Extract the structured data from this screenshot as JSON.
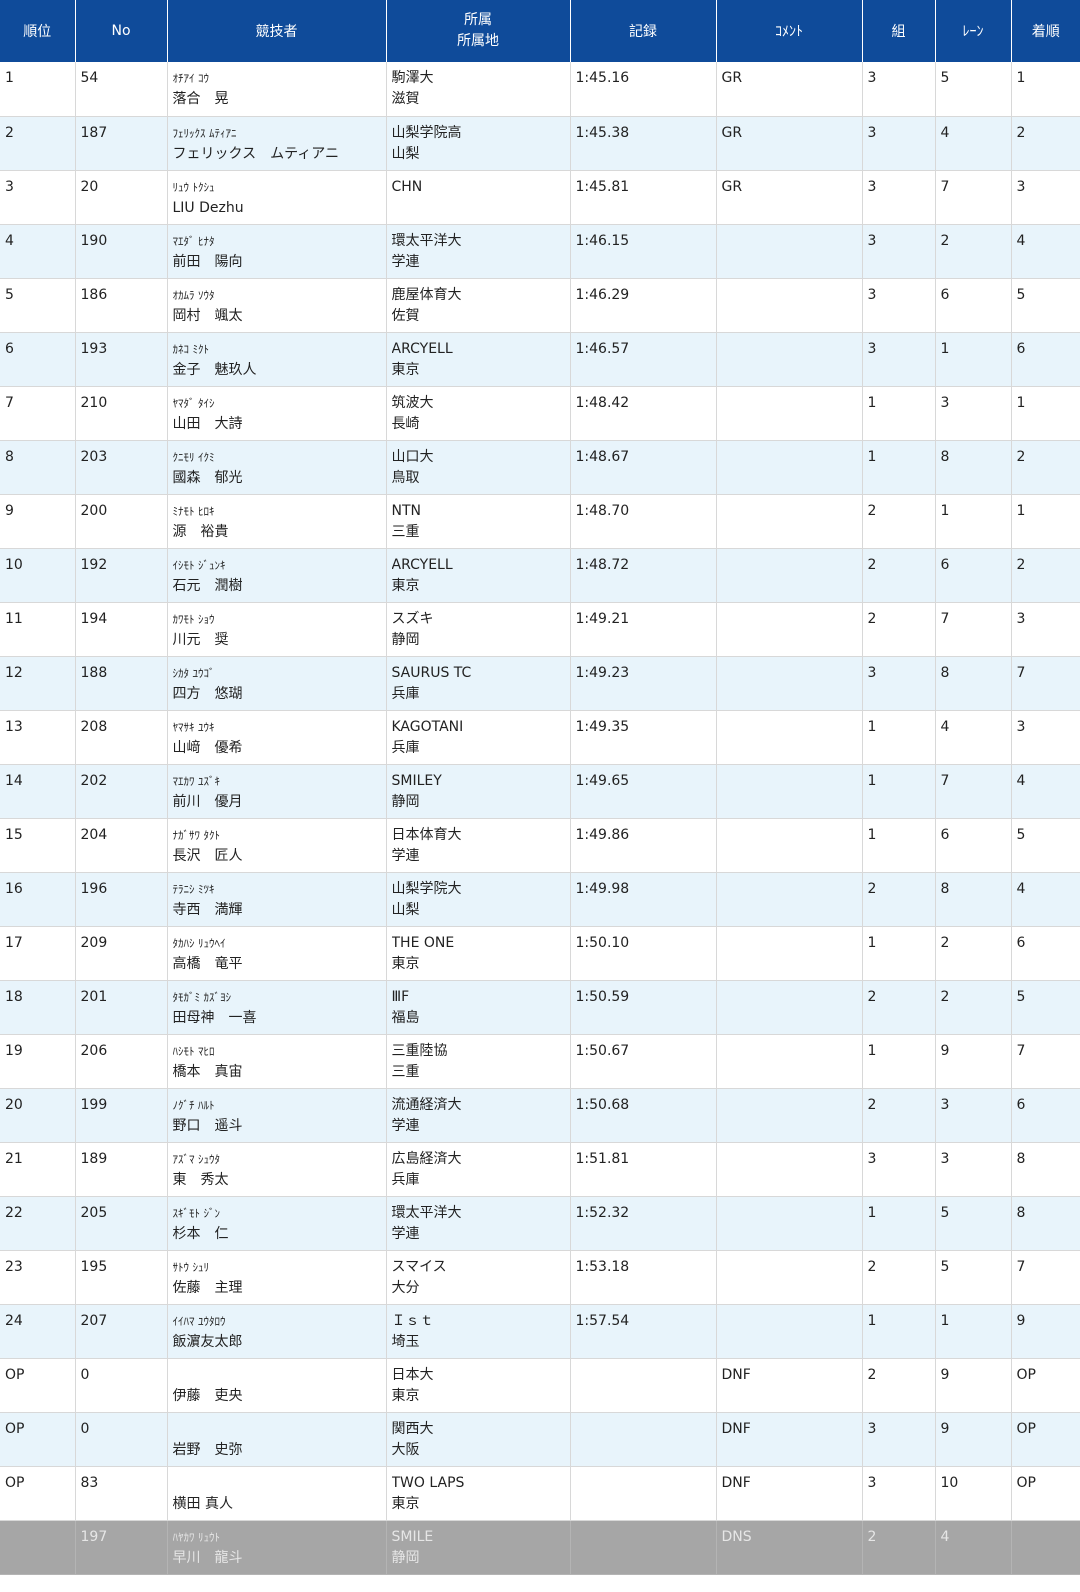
{
  "header": {
    "rank": "順位",
    "no": "No",
    "athlete": "競技者",
    "affil_1": "所属",
    "affil_2": "所属地",
    "record": "記録",
    "comment": "ｺﾒﾝﾄ",
    "heat": "組",
    "lane": "ﾚｰﾝ",
    "order": "着順"
  },
  "rows": [
    {
      "rank": "1",
      "no": "54",
      "kana": "ｵﾁｱｲ ｺｳ",
      "name": "落合　晃",
      "affil": "駒澤大",
      "region": "滋賀",
      "record": "1:45.16",
      "comment": "GR",
      "heat": "3",
      "lane": "5",
      "order": "1"
    },
    {
      "rank": "2",
      "no": "187",
      "kana": "ﾌｪﾘｯｸｽ ﾑﾃｨｱﾆ",
      "name": "フェリックス　ムティアニ",
      "affil": "山梨学院高",
      "region": "山梨",
      "record": "1:45.38",
      "comment": "GR",
      "heat": "3",
      "lane": "4",
      "order": "2"
    },
    {
      "rank": "3",
      "no": "20",
      "kana": "ﾘｭｳ ﾄｸｼｭ",
      "name": "LIU Dezhu",
      "affil": "CHN",
      "region": "",
      "record": "1:45.81",
      "comment": "GR",
      "heat": "3",
      "lane": "7",
      "order": "3"
    },
    {
      "rank": "4",
      "no": "190",
      "kana": "ﾏｴﾀﾞ ﾋﾅﾀ",
      "name": "前田　陽向",
      "affil": "環太平洋大",
      "region": "学連",
      "record": "1:46.15",
      "comment": "",
      "heat": "3",
      "lane": "2",
      "order": "4"
    },
    {
      "rank": "5",
      "no": "186",
      "kana": "ｵｶﾑﾗ ｿｳﾀ",
      "name": "岡村　颯太",
      "affil": "鹿屋体育大",
      "region": "佐賀",
      "record": "1:46.29",
      "comment": "",
      "heat": "3",
      "lane": "6",
      "order": "5"
    },
    {
      "rank": "6",
      "no": "193",
      "kana": "ｶﾈｺ ﾐｸﾄ",
      "name": "金子　魅玖人",
      "affil": "ARCYELL",
      "region": "東京",
      "record": "1:46.57",
      "comment": "",
      "heat": "3",
      "lane": "1",
      "order": "6"
    },
    {
      "rank": "7",
      "no": "210",
      "kana": "ﾔﾏﾀﾞ ﾀｲｼ",
      "name": "山田　大詩",
      "affil": "筑波大",
      "region": "長崎",
      "record": "1:48.42",
      "comment": "",
      "heat": "1",
      "lane": "3",
      "order": "1"
    },
    {
      "rank": "8",
      "no": "203",
      "kana": "ｸﾆﾓﾘ ｲｸﾐ",
      "name": "國森　郁光",
      "affil": "山口大",
      "region": "鳥取",
      "record": "1:48.67",
      "comment": "",
      "heat": "1",
      "lane": "8",
      "order": "2"
    },
    {
      "rank": "9",
      "no": "200",
      "kana": "ﾐﾅﾓﾄ ﾋﾛｷ",
      "name": "源　裕貴",
      "affil": "NTN",
      "region": "三重",
      "record": "1:48.70",
      "comment": "",
      "heat": "2",
      "lane": "1",
      "order": "1"
    },
    {
      "rank": "10",
      "no": "192",
      "kana": "ｲｼﾓﾄ ｼﾞｭﾝｷ",
      "name": "石元　潤樹",
      "affil": "ARCYELL",
      "region": "東京",
      "record": "1:48.72",
      "comment": "",
      "heat": "2",
      "lane": "6",
      "order": "2"
    },
    {
      "rank": "11",
      "no": "194",
      "kana": "ｶﾜﾓﾄ ｼｮｳ",
      "name": "川元　奨",
      "affil": "スズキ",
      "region": "静岡",
      "record": "1:49.21",
      "comment": "",
      "heat": "2",
      "lane": "7",
      "order": "3"
    },
    {
      "rank": "12",
      "no": "188",
      "kana": "ｼｶﾀ ﾕｳｺﾞ",
      "name": "四方　悠瑚",
      "affil": "SAURUS TC",
      "region": "兵庫",
      "record": "1:49.23",
      "comment": "",
      "heat": "3",
      "lane": "8",
      "order": "7"
    },
    {
      "rank": "13",
      "no": "208",
      "kana": "ﾔﾏｻｷ ﾕｳｷ",
      "name": "山﨑　優希",
      "affil": "KAGOTANI",
      "region": "兵庫",
      "record": "1:49.35",
      "comment": "",
      "heat": "1",
      "lane": "4",
      "order": "3"
    },
    {
      "rank": "14",
      "no": "202",
      "kana": "ﾏｴｶﾜ ﾕｽﾞｷ",
      "name": "前川　優月",
      "affil": "SMILEY",
      "region": "静岡",
      "record": "1:49.65",
      "comment": "",
      "heat": "1",
      "lane": "7",
      "order": "4"
    },
    {
      "rank": "15",
      "no": "204",
      "kana": "ﾅｶﾞｻﾜ ﾀｸﾄ",
      "name": "長沢　匠人",
      "affil": "日本体育大",
      "region": "学連",
      "record": "1:49.86",
      "comment": "",
      "heat": "1",
      "lane": "6",
      "order": "5"
    },
    {
      "rank": "16",
      "no": "196",
      "kana": "ﾃﾗﾆｼ ﾐﾂｷ",
      "name": "寺西　満輝",
      "affil": "山梨学院大",
      "region": "山梨",
      "record": "1:49.98",
      "comment": "",
      "heat": "2",
      "lane": "8",
      "order": "4"
    },
    {
      "rank": "17",
      "no": "209",
      "kana": "ﾀｶﾊｼ ﾘｭｳﾍｲ",
      "name": "高橋　竜平",
      "affil": "THE ONE",
      "region": "東京",
      "record": "1:50.10",
      "comment": "",
      "heat": "1",
      "lane": "2",
      "order": "6"
    },
    {
      "rank": "18",
      "no": "201",
      "kana": "ﾀﾓｶﾞﾐ ｶｽﾞﾖｼ",
      "name": "田母神　一喜",
      "affil": "ⅢF",
      "region": "福島",
      "record": "1:50.59",
      "comment": "",
      "heat": "2",
      "lane": "2",
      "order": "5"
    },
    {
      "rank": "19",
      "no": "206",
      "kana": "ﾊｼﾓﾄ ﾏﾋﾛ",
      "name": "橋本　真宙",
      "affil": "三重陸協",
      "region": "三重",
      "record": "1:50.67",
      "comment": "",
      "heat": "1",
      "lane": "9",
      "order": "7"
    },
    {
      "rank": "20",
      "no": "199",
      "kana": "ﾉｸﾞﾁ ﾊﾙﾄ",
      "name": "野口　遥斗",
      "affil": "流通経済大",
      "region": "学連",
      "record": "1:50.68",
      "comment": "",
      "heat": "2",
      "lane": "3",
      "order": "6"
    },
    {
      "rank": "21",
      "no": "189",
      "kana": "ｱｽﾞﾏ ｼｭｳﾀ",
      "name": "東　秀太",
      "affil": "広島経済大",
      "region": "兵庫",
      "record": "1:51.81",
      "comment": "",
      "heat": "3",
      "lane": "3",
      "order": "8"
    },
    {
      "rank": "22",
      "no": "205",
      "kana": "ｽｷﾞﾓﾄ ｼﾞﾝ",
      "name": "杉本　仁",
      "affil": "環太平洋大",
      "region": "学連",
      "record": "1:52.32",
      "comment": "",
      "heat": "1",
      "lane": "5",
      "order": "8"
    },
    {
      "rank": "23",
      "no": "195",
      "kana": "ｻﾄｳ ｼｭﾘ",
      "name": "佐藤　主理",
      "affil": "スマイス",
      "region": "大分",
      "record": "1:53.18",
      "comment": "",
      "heat": "2",
      "lane": "5",
      "order": "7"
    },
    {
      "rank": "24",
      "no": "207",
      "kana": "ｲｲﾊﾏ ﾕｳﾀﾛｳ",
      "name": "飯濵友太郎",
      "affil": "Ｉｓｔ",
      "region": "埼玉",
      "record": "1:57.54",
      "comment": "",
      "heat": "1",
      "lane": "1",
      "order": "9"
    },
    {
      "rank": "OP",
      "no": "0",
      "kana": "",
      "name": "伊藤　吏央",
      "affil": "日本大",
      "region": "東京",
      "record": "",
      "comment": "DNF",
      "heat": "2",
      "lane": "9",
      "order": "OP"
    },
    {
      "rank": "OP",
      "no": "0",
      "kana": "",
      "name": "岩野　史弥",
      "affil": "関西大",
      "region": "大阪",
      "record": "",
      "comment": "DNF",
      "heat": "3",
      "lane": "9",
      "order": "OP"
    },
    {
      "rank": "OP",
      "no": "83",
      "kana": "",
      "name": "横田 真人",
      "affil": "TWO LAPS",
      "region": "東京",
      "record": "",
      "comment": "DNF",
      "heat": "3",
      "lane": "10",
      "order": "OP"
    },
    {
      "rank": "",
      "no": "197",
      "kana": "ﾊﾔｶﾜ ﾘｭｳﾄ",
      "name": "早川　龍斗",
      "affil": "SMILE",
      "region": "静岡",
      "record": "",
      "comment": "DNS",
      "heat": "2",
      "lane": "4",
      "order": ""
    }
  ]
}
